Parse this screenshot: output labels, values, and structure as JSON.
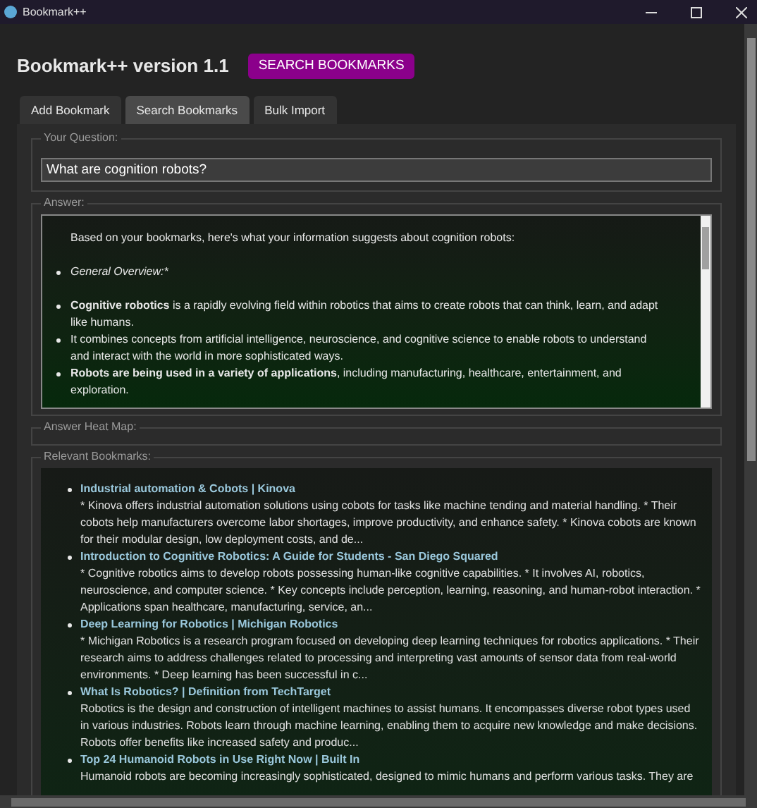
{
  "window": {
    "title": "Bookmark++"
  },
  "header": {
    "title": "Bookmark++ version 1.1",
    "button": "SEARCH BOOKMARKS"
  },
  "tabs": [
    {
      "label": "Add Bookmark",
      "selected": false
    },
    {
      "label": "Search Bookmarks",
      "selected": true
    },
    {
      "label": "Bulk Import",
      "selected": false
    }
  ],
  "question": {
    "legend": "Your Question:",
    "value": "What are cognition robots?"
  },
  "answer": {
    "legend": "Answer:",
    "items": [
      {
        "kind": "para",
        "text": "Based on your bookmarks, here's what your information suggests about cognition robots:"
      },
      {
        "kind": "bullet",
        "text": "General Overview:*",
        "italic": true
      },
      {
        "kind": "gap"
      },
      {
        "kind": "bullet",
        "text": "**Cognitive robotics** is a rapidly evolving field within robotics that aims to create robots that can think, learn, and adapt like humans.",
        "italic": false
      },
      {
        "kind": "bullet",
        "text": "It combines concepts from artificial intelligence, neuroscience, and cognitive science to enable robots to understand and interact with the world in more sophisticated ways.",
        "italic": false
      },
      {
        "kind": "bullet",
        "text": "**Robots are being used in a variety of applications**, including manufacturing, healthcare, entertainment, and exploration.",
        "italic": false
      }
    ]
  },
  "heat_map": {
    "legend": "Answer Heat Map:"
  },
  "bookmarks": {
    "legend": "Relevant Bookmarks:",
    "items": [
      {
        "title": "Industrial automation & Cobots | Kinova",
        "summary": "* Kinova offers industrial automation solutions using cobots for tasks like machine tending and material handling. * Their cobots help manufacturers overcome labor shortages, improve productivity, and enhance safety. * Kinova cobots are known for their modular design, low deployment costs, and de..."
      },
      {
        "title": "Introduction to Cognitive Robotics: A Guide for Students - San Diego Squared",
        "summary": "* Cognitive robotics aims to develop robots possessing human-like cognitive capabilities. * It involves AI, robotics, neuroscience, and computer science. * Key concepts include perception, learning, reasoning, and human-robot interaction. * Applications span healthcare, manufacturing, service, an..."
      },
      {
        "title": "Deep Learning for Robotics | Michigan Robotics",
        "summary": "* Michigan Robotics is a research program focused on developing deep learning techniques for robotics applications. * Their research aims to address challenges related to processing and interpreting vast amounts of sensor data from real-world environments. * Deep learning has been successful in c..."
      },
      {
        "title": "What Is Robotics? | Definition from TechTarget",
        "summary": "Robotics is the design and construction of intelligent machines to assist humans. It encompasses diverse robot types used in various industries. Robots learn through machine learning, enabling them to acquire new knowledge and make decisions. Robots offer benefits like increased safety and produc..."
      },
      {
        "title": "Top 24 Humanoid Robots in Use Right Now | Built In",
        "summary": "Humanoid robots are becoming increasingly sophisticated, designed to mimic humans and perform various tasks. They are"
      }
    ]
  }
}
